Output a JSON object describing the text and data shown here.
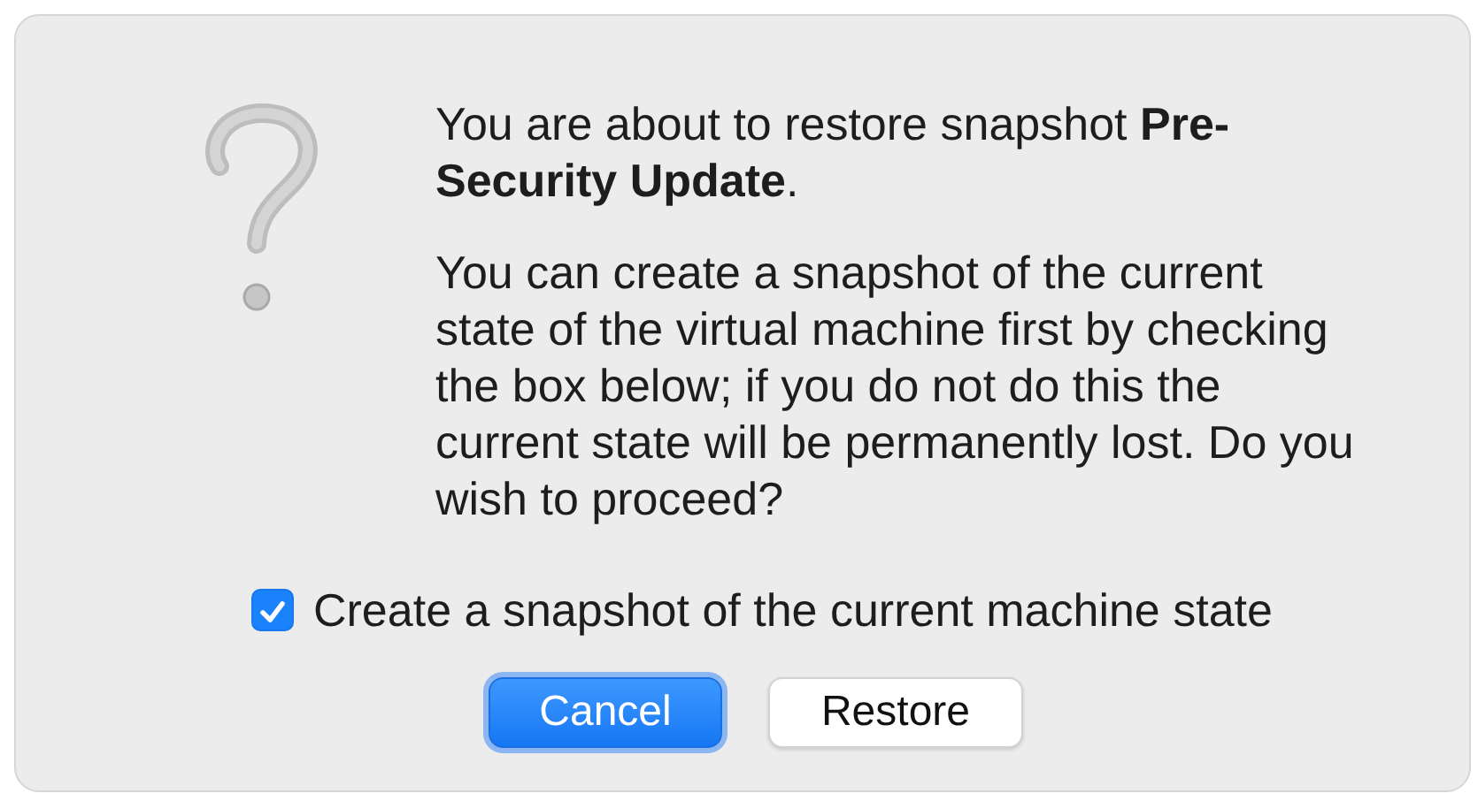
{
  "dialog": {
    "message": "You are about to restore snapshot **Pre-Security Update**.",
    "details": "You can create a snapshot of the current state of the virtual machine first by checking the box below; if you do not do this the current state will be permanently lost. Do you wish to proceed?",
    "checkbox": {
      "label": "Create a snapshot of the current machine state",
      "checked": true
    },
    "buttons": [
      {
        "label": "Cancel",
        "default": true
      },
      {
        "label": "Restore",
        "default": false
      }
    ]
  }
}
